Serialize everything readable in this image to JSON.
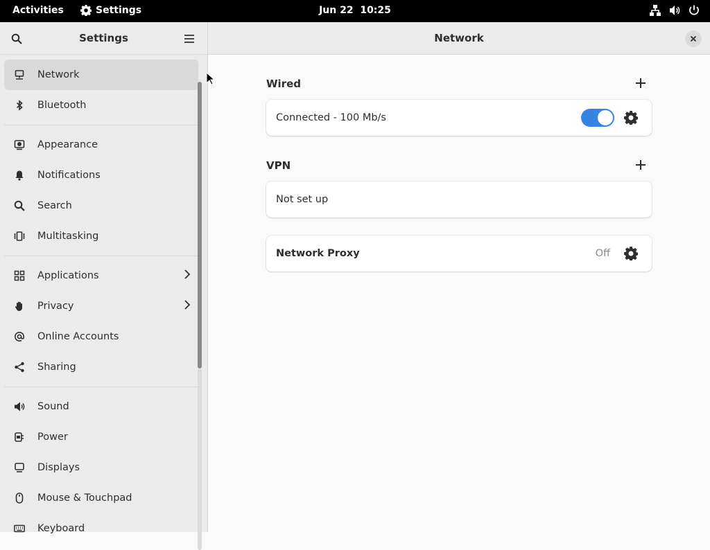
{
  "topbar": {
    "activities": "Activities",
    "app_name": "Settings",
    "date": "Jun 22",
    "time": "10:25",
    "tray_icons": [
      "network-wired-icon",
      "volume-icon",
      "power-icon"
    ]
  },
  "sidebar": {
    "title": "Settings",
    "items": [
      {
        "label": "Network",
        "icon": "network-icon",
        "active": true
      },
      {
        "label": "Bluetooth",
        "icon": "bluetooth-icon"
      },
      {
        "label": "Appearance",
        "icon": "appearance-icon"
      },
      {
        "label": "Notifications",
        "icon": "bell-icon"
      },
      {
        "label": "Search",
        "icon": "search-icon"
      },
      {
        "label": "Multitasking",
        "icon": "multitasking-icon"
      },
      {
        "label": "Applications",
        "icon": "apps-grid-icon",
        "has_submenu": true
      },
      {
        "label": "Privacy",
        "icon": "hand-icon",
        "has_submenu": true
      },
      {
        "label": "Online Accounts",
        "icon": "at-icon"
      },
      {
        "label": "Sharing",
        "icon": "share-icon"
      },
      {
        "label": "Sound",
        "icon": "speaker-icon"
      },
      {
        "label": "Power",
        "icon": "power-plug-icon"
      },
      {
        "label": "Displays",
        "icon": "display-icon"
      },
      {
        "label": "Mouse & Touchpad",
        "icon": "mouse-icon"
      },
      {
        "label": "Keyboard",
        "icon": "keyboard-icon"
      }
    ]
  },
  "main": {
    "title": "Network",
    "wired": {
      "section_title": "Wired",
      "status": "Connected - 100 Mb/s",
      "enabled": true
    },
    "vpn": {
      "section_title": "VPN",
      "status": "Not set up"
    },
    "proxy": {
      "label": "Network Proxy",
      "state": "Off"
    }
  },
  "colors": {
    "accent": "#3584e4",
    "topbar_bg": "#000000",
    "sidebar_bg": "#ebebeb",
    "content_bg": "#fafafa"
  }
}
